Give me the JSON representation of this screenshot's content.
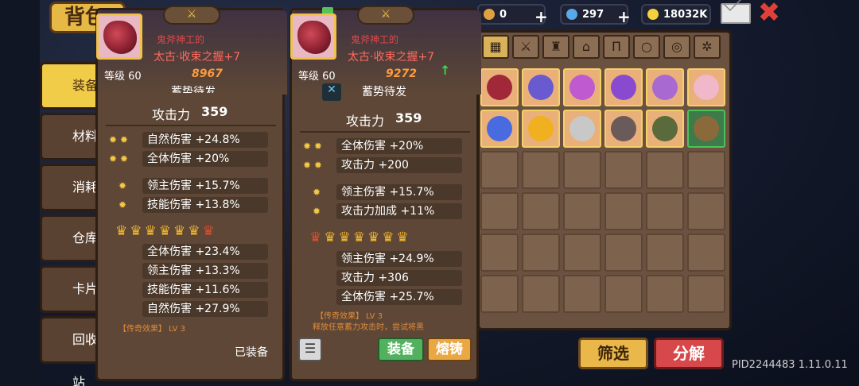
{
  "header": {
    "title": "背包"
  },
  "resources": [
    {
      "name": "gold-keys",
      "value": "0"
    },
    {
      "name": "gems",
      "value": "297"
    },
    {
      "name": "coins",
      "value": "18032K"
    }
  ],
  "sidebar": {
    "items": [
      {
        "label": "装备"
      },
      {
        "label": "材料"
      },
      {
        "label": "消耗品"
      },
      {
        "label": "仓库"
      },
      {
        "label": "卡片"
      },
      {
        "label": "回收站"
      }
    ]
  },
  "card_left": {
    "quality": "鬼斧神工的",
    "name": "太古·收束之握+7",
    "level": "等级 60",
    "power": "8967",
    "skill": "蓄势待发",
    "attack": "攻击力",
    "attack_value": "359",
    "stats_a": [
      "自然伤害 +24.8%",
      "全体伤害 +20%"
    ],
    "stats_b": [
      "领主伤害 +15.7%",
      "技能伤害 +13.8%"
    ],
    "stats_c": [
      "全体伤害 +23.4%",
      "领主伤害 +13.3%",
      "技能伤害 +11.6%",
      "自然伤害 +27.9%"
    ],
    "legend": "【传奇效果】 LV 3",
    "status": "已装备"
  },
  "card_right": {
    "quality": "鬼斧神工的",
    "name": "太古·收束之握+7",
    "level": "等级 60",
    "power": "9272",
    "skill": "蓄势待发",
    "attack": "攻击力",
    "attack_value": "359",
    "stats_a": [
      "全体伤害 +20%",
      "攻击力 +200"
    ],
    "stats_b": [
      "领主伤害 +15.7%",
      "攻击力加成 +11%"
    ],
    "stats_c": [
      "领主伤害 +24.9%",
      "攻击力 +306",
      "全体伤害 +25.7%"
    ],
    "legend": "【传奇效果】 LV 3",
    "legend_desc": "释放任意蓄力攻击时，尝试将黑",
    "btn_equip": "装备",
    "btn_forge": "熔铸"
  },
  "buttons": {
    "filter": "筛选",
    "decompose": "分解"
  },
  "footer": {
    "pid": "PID2244483 1.11.0.11"
  },
  "colors": {
    "accent": "#f0cc48",
    "danger": "#d6484a",
    "legend": "#e08a3a",
    "item_name": "#ff6a5a"
  }
}
